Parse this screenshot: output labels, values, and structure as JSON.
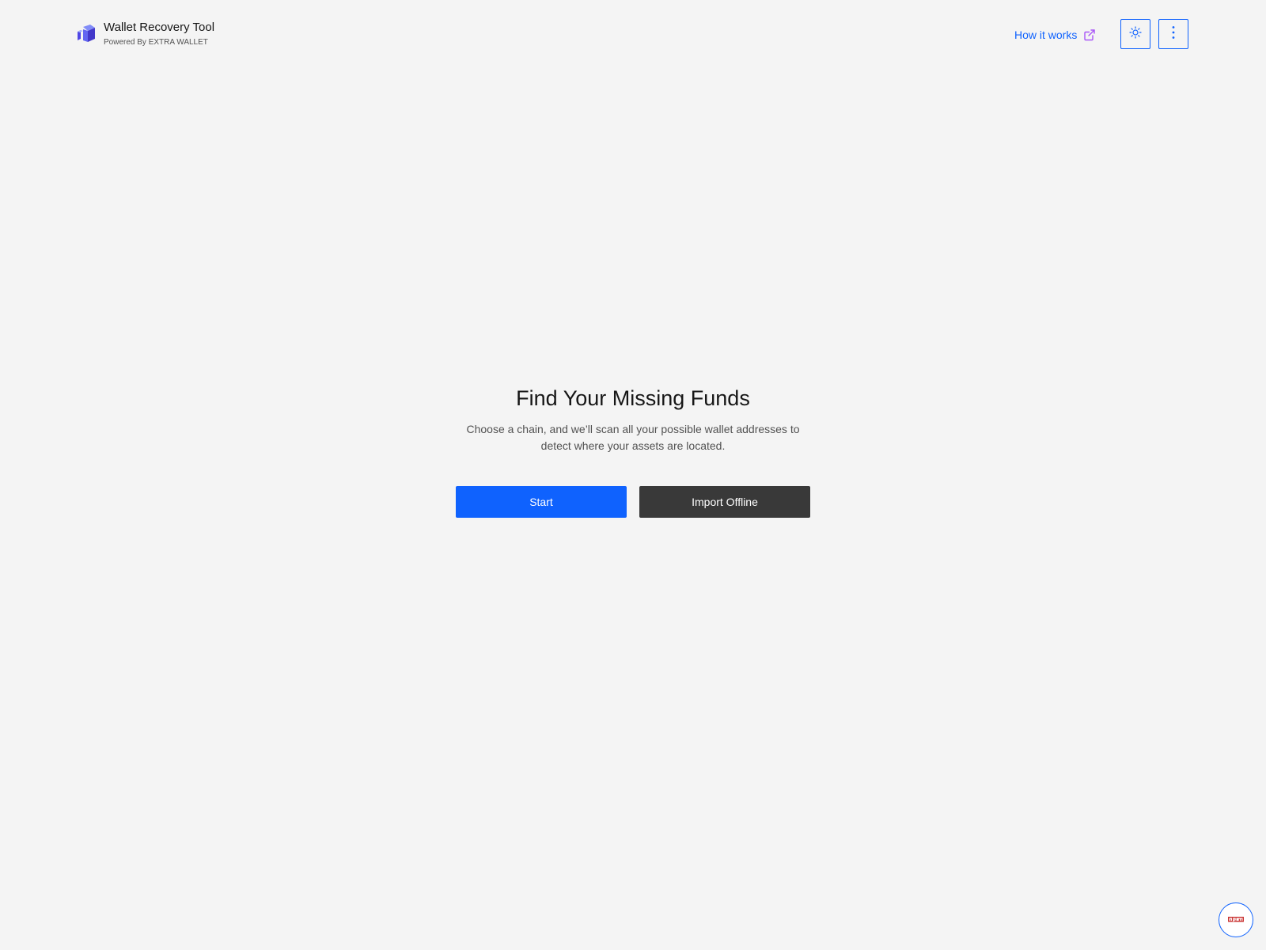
{
  "header": {
    "app_title": "Wallet Recovery Tool",
    "powered_by": "Powered By EXTRA WALLET",
    "logo_icon": "cube-logo-icon",
    "how_it_works_label": "How it works",
    "how_it_works_icon": "external-link-icon",
    "theme_toggle_icon": "sun-icon",
    "menu_icon": "vertical-dots-icon"
  },
  "hero": {
    "title": "Find Your Missing Funds",
    "description": "Choose a chain, and we’ll scan all your possible wallet addresses to detect where your assets are located."
  },
  "actions": {
    "start_label": "Start",
    "import_label": "Import Offline"
  },
  "floating_badge": {
    "icon": "npm-icon",
    "label": "npm"
  },
  "colors": {
    "background": "#f4f4f4",
    "primary": "#0f62fe",
    "secondary_button": "#393939",
    "link_icon": "#a855f7",
    "logo": "#4f46e5"
  }
}
